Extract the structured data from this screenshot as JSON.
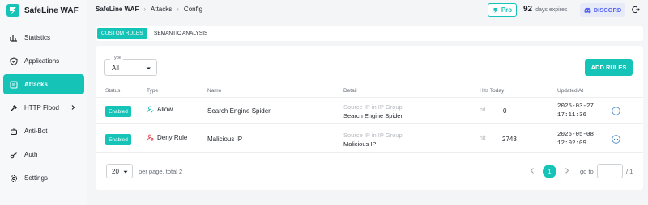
{
  "app": {
    "name": "SafeLine WAF"
  },
  "colors": {
    "accent": "#15c3b7",
    "discord": "#5865f2"
  },
  "sidebar": {
    "items": [
      {
        "label": "Statistics",
        "icon": "chart-bar-icon"
      },
      {
        "label": "Applications",
        "icon": "shield-icon"
      },
      {
        "label": "Attacks",
        "icon": "attack-log-icon",
        "active": true
      },
      {
        "label": "HTTP Flood",
        "icon": "hammer-icon",
        "has_submenu": true
      },
      {
        "label": "Anti-Bot",
        "icon": "bot-icon"
      },
      {
        "label": "Auth",
        "icon": "key-icon"
      },
      {
        "label": "Settings",
        "icon": "gear-icon"
      }
    ]
  },
  "header": {
    "breadcrumb": [
      "SafeLine WAF",
      "Attacks",
      "Config"
    ],
    "pro_label": "Pro",
    "days_count": "92",
    "days_label": "days expires",
    "discord_label": "DISCORD"
  },
  "tabs": [
    {
      "label": "CUSTOM RULES",
      "active": true
    },
    {
      "label": "SEMANTIC ANALYSIS",
      "active": false
    }
  ],
  "filter": {
    "type_legend": "Type",
    "type_value": "All"
  },
  "add_rules_label": "ADD RULES",
  "table": {
    "columns": [
      "Status",
      "Type",
      "Name",
      "Detail",
      "Hits Today",
      "Updated At"
    ],
    "rows": [
      {
        "status": "Enabled",
        "type": "Allow",
        "name": "Search Engine Spider",
        "detail_label": "Source IP in IP Group",
        "detail_value": "Search Engine Spider",
        "hit_label": "hit",
        "hits": "0",
        "updated_date": "2025-03-27",
        "updated_time": "17:11:36"
      },
      {
        "status": "Enabled",
        "type": "Deny Rule",
        "name": "Malicious IP",
        "detail_label": "Source IP in IP Group",
        "detail_value": "Malicious IP",
        "hit_label": "hit",
        "hits": "2743",
        "updated_date": "2025-05-08",
        "updated_time": "12:02:09"
      }
    ]
  },
  "pagination": {
    "page_size": "20",
    "per_page_text": "per page, total 2",
    "current_page": "1",
    "goto_label": "go to",
    "total_pages": "/ 1"
  }
}
